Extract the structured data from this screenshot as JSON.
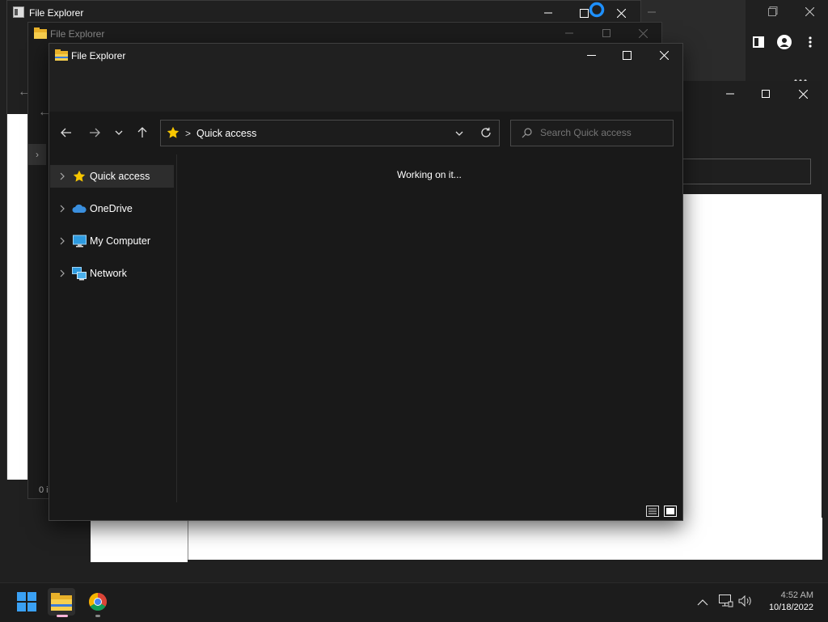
{
  "background_window": {
    "title": "File Explorer",
    "status_fragment": "0 i"
  },
  "middle_window": {
    "title": "File Explorer"
  },
  "front_window": {
    "title": "File Explorer",
    "breadcrumb_separator": ">",
    "location": "Quick access",
    "search_placeholder": "Search Quick access",
    "loading_text": "Working on it...",
    "nav_items": [
      {
        "label": "Quick access",
        "icon": "star-icon"
      },
      {
        "label": "OneDrive",
        "icon": "cloud-icon"
      },
      {
        "label": "My Computer",
        "icon": "computer-icon"
      },
      {
        "label": "Network",
        "icon": "network-icon"
      }
    ]
  },
  "taskbar": {
    "time": "4:52 AM",
    "date": "10/18/2022",
    "pinned": [
      "windows-start-icon",
      "file-explorer-icon",
      "chrome-icon"
    ],
    "tray": [
      "chevron-up-icon",
      "network-icon",
      "volume-icon"
    ]
  },
  "colors": {
    "window_bg": "#191919",
    "titlebar_bg": "#202020",
    "sidebar_selected": "#2d2d2d",
    "accent": "#4cc2ff",
    "star": "#f7c600"
  }
}
